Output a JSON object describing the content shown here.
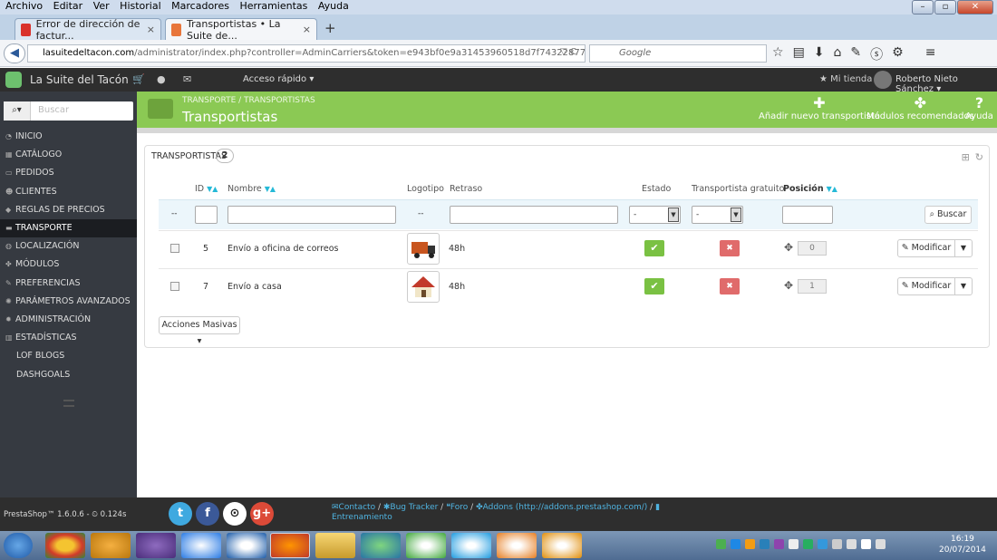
{
  "browser": {
    "menu": [
      "Archivo",
      "Editar",
      "Ver",
      "Historial",
      "Marcadores",
      "Herramientas",
      "Ayuda"
    ],
    "tabs": [
      {
        "label": "Error de dirección de factur...",
        "close": "×"
      },
      {
        "label": "Transportistas • La Suite de...",
        "close": "×"
      }
    ],
    "new_tab": "+",
    "url_domain": "lasuitedeltacon.com",
    "url_rest": "/administrator/index.php?controller=AdminCarriers&token=e943bf0e9a31453960518d7f74322877",
    "search_placeholder": "Google"
  },
  "app": {
    "shop_name": "La Suite del Tacón",
    "quick_access": "Acceso rápido",
    "my_shop": "Mi tienda",
    "user": "Roberto Nieto Sánchez",
    "search_placeholder": "Buscar"
  },
  "header": {
    "breadcrumb": "TRANSPORTE  /  TRANSPORTISTAS",
    "title": "Transportistas",
    "actions": [
      {
        "label": "Añadir nuevo transportista",
        "icon": "plus-icon"
      },
      {
        "label": "Módulos recomendados",
        "icon": "puzzle-icon"
      },
      {
        "label": "Ayuda",
        "icon": "help-icon"
      }
    ]
  },
  "sidebar": {
    "items": [
      {
        "label": "INICIO",
        "icon": "dashboard-icon"
      },
      {
        "label": "CATÁLOGO",
        "icon": "catalog-icon"
      },
      {
        "label": "PEDIDOS",
        "icon": "orders-icon"
      },
      {
        "label": "CLIENTES",
        "icon": "customers-icon"
      },
      {
        "label": "REGLAS DE PRECIOS",
        "icon": "tag-icon"
      },
      {
        "label": "TRANSPORTE",
        "icon": "truck-icon",
        "active": true
      },
      {
        "label": "LOCALIZACIÓN",
        "icon": "globe-icon"
      },
      {
        "label": "MÓDULOS",
        "icon": "puzzle-icon"
      },
      {
        "label": "PREFERENCIAS",
        "icon": "wrench-icon"
      },
      {
        "label": "PARÁMETROS AVANZADOS",
        "icon": "cogs-icon"
      },
      {
        "label": "ADMINISTRACIÓN",
        "icon": "cog-icon"
      },
      {
        "label": "ESTADÍSTICAS",
        "icon": "chart-icon"
      },
      {
        "label": "LOF BLOGS",
        "icon": ""
      },
      {
        "label": "DASHGOALS",
        "icon": ""
      }
    ]
  },
  "panel": {
    "title": "TRANSPORTISTAS",
    "count": "2",
    "columns": {
      "id": "ID",
      "name": "Nombre",
      "logo": "Logotipo",
      "delay": "Retraso",
      "status": "Estado",
      "free": "Transportista gratuito",
      "position": "Posición"
    },
    "filter": {
      "dash": "--",
      "logo_dash": "--",
      "status": "-",
      "free": "-",
      "search_button": "Buscar"
    },
    "rows": [
      {
        "id": "5",
        "name": "Envío a oficina de correos",
        "delay": "48h",
        "position": "0",
        "edit": "Modificar"
      },
      {
        "id": "7",
        "name": "Envío a casa",
        "delay": "48h",
        "position": "1",
        "edit": "Modificar"
      }
    ],
    "bulk": "Acciones Masivas"
  },
  "footer": {
    "version": "PrestaShop™ 1.6.0.6 - ⏲ 0.124s",
    "social": [
      "t",
      "f",
      "gh",
      "g+"
    ],
    "links": [
      "Contacto",
      "Bug Tracker",
      "Foro",
      "Addons (http://addons.prestashop.com/)",
      "Entrenamiento"
    ]
  },
  "taskbar": {
    "time": "16:19",
    "date": "20/07/2014"
  },
  "colors": {
    "accent_green": "#8bc954",
    "sidebar": "#363a41",
    "topbar": "#2e2e2e",
    "link_blue": "#25b9d7"
  }
}
